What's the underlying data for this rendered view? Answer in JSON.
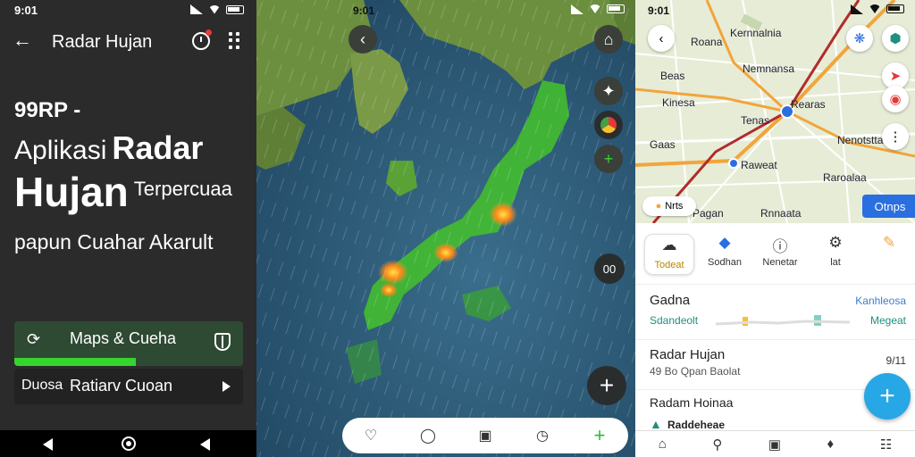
{
  "left": {
    "status_time": "9:01",
    "title": "Radar Hujan",
    "hero_line1": "99RP -",
    "hero_line2a": "Aplikasi",
    "hero_line2b": "Radar",
    "hero_line3a": "Hujan",
    "hero_line3b": "Terpercuaa",
    "hero_line4": "papun Cuahar Akarult",
    "maps_label": "Maps & Cueha",
    "maps_progress": 0.53,
    "radar_label1": "Duosa",
    "radar_label2": "Ratiarv Cuoan",
    "accent": "#35d52f"
  },
  "middle": {
    "status_time": "9:01",
    "zoom_label": "00",
    "colors": {
      "ocean": "#2c5b7a",
      "land": "#6c8f3f",
      "rain": "#44c22a",
      "heavy": "#ff9a1a"
    }
  },
  "right": {
    "status_time": "9:01",
    "map_labels": {
      "l1": "Kernnalnia",
      "l2": "Roana",
      "l3": "Nemnansa",
      "l4": "Beas",
      "l5": "Kinesa",
      "l6": "Rearas",
      "l7": "Tenas",
      "l8": "Gaas",
      "l9": "Nenotstta",
      "l10": "Raweat",
      "l11": "Rnnaata",
      "l12": "Raroalaa",
      "l13": "Pagan"
    },
    "chip_label": "Nrts",
    "blue_chip": "Otnps",
    "categories": [
      {
        "icon": "rain-icon",
        "glyph": "☁",
        "label": "Todeat"
      },
      {
        "icon": "shield-icon",
        "glyph": "◆",
        "label": "Sodhan"
      },
      {
        "icon": "alert-icon",
        "glyph": "ⓘ",
        "label": "Nenetar"
      },
      {
        "icon": "settings-icon",
        "glyph": "⚙",
        "label": "lat"
      },
      {
        "icon": "tag-icon",
        "glyph": "✎",
        "label": ""
      }
    ],
    "row1": {
      "title": "Gadna",
      "right": "Kanhleosa",
      "left_sub": "Sdandeolt",
      "right_sub": "Megeat"
    },
    "row2": {
      "title": "Radar Hujan",
      "right": "9/11",
      "sub": "49 Bo Qpan Baolat"
    },
    "row3": {
      "title": "Radam Hoinaa",
      "sub": "Raddeheae"
    }
  }
}
